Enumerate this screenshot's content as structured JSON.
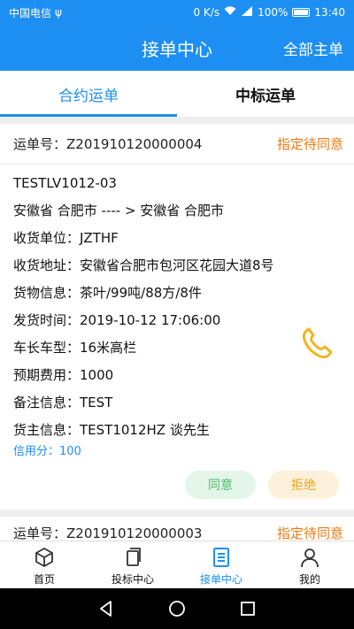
{
  "status_bar": {
    "carrier": "中国电信",
    "usb_symbol": "ψ",
    "speed": "0 K/s",
    "battery": "100%",
    "time": "13:40"
  },
  "header": {
    "title": "接单中心",
    "action": "全部主单"
  },
  "tabs": [
    {
      "label": "合约运单",
      "active": true
    },
    {
      "label": "中标运单",
      "active": false
    }
  ],
  "orders": [
    {
      "number_label": "运单号：",
      "number": "Z201910120000004",
      "status": "指定待同意",
      "code": "TESTLV1012-03",
      "route": "安徽省 合肥市  ---- >  安徽省 合肥市",
      "receiver": "收货单位：JZTHF",
      "address": "收货地址：安徽省合肥市包河区花园大道8号",
      "goods": "货物信息：茶叶/99吨/88方/8件",
      "ship_time": "发货时间：2019-10-12 17:06:00",
      "truck": "车长车型：16米高栏",
      "expected_cost": "预期费用：1000",
      "remark": "备注信息：TEST",
      "shipper": "货主信息：TEST1012HZ  谈先生",
      "credit": "信用分：100",
      "agree": "同意",
      "reject": "拒绝"
    },
    {
      "number_label": "运单号：",
      "number": "Z201910120000003",
      "status": "指定待同意"
    }
  ],
  "bottom_nav": [
    {
      "label": "首页",
      "icon": "cube-icon",
      "active": false
    },
    {
      "label": "投标中心",
      "icon": "copy-icon",
      "active": false
    },
    {
      "label": "接单中心",
      "icon": "document-list-icon",
      "active": true
    },
    {
      "label": "我的",
      "icon": "person-icon",
      "active": false
    }
  ],
  "colors": {
    "primary": "#1d8ff2",
    "status_orange": "#f0790f",
    "agree_green": "#4bbf67",
    "reject_orange": "#f0a21a",
    "phone_yellow": "#f2b51d"
  }
}
